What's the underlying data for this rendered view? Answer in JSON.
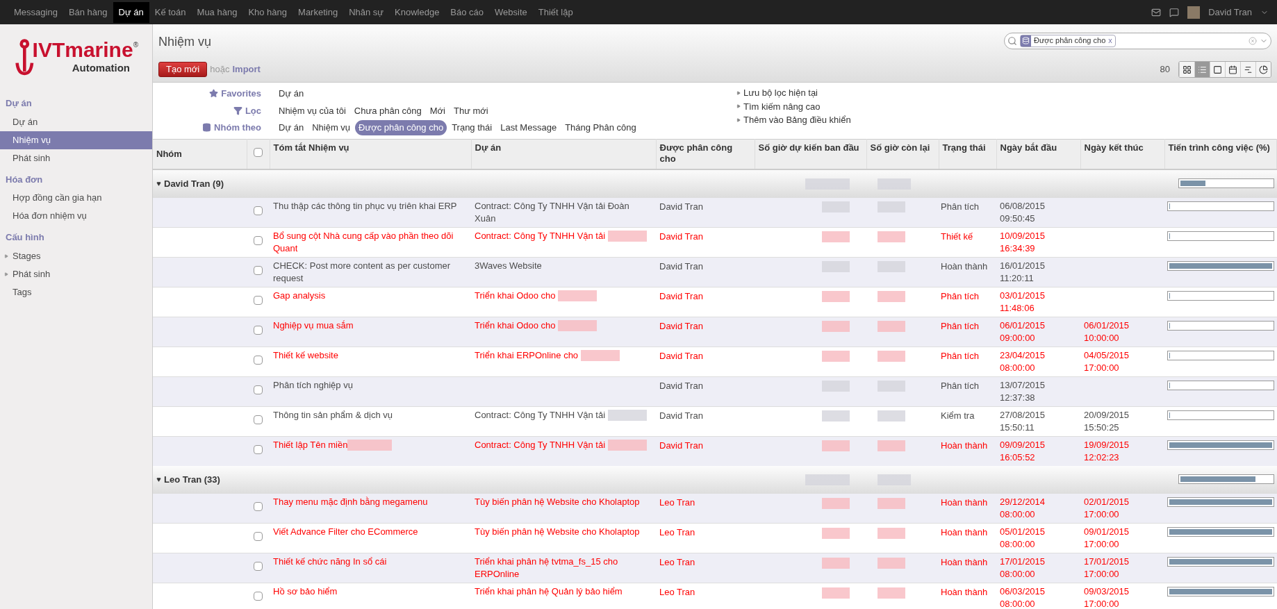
{
  "top_menu": [
    {
      "label": "Messaging",
      "selected": false
    },
    {
      "label": "Bán hàng",
      "selected": false
    },
    {
      "label": "Dự án",
      "selected": true
    },
    {
      "label": "Kế toán",
      "selected": false
    },
    {
      "label": "Mua hàng",
      "selected": false
    },
    {
      "label": "Kho hàng",
      "selected": false
    },
    {
      "label": "Marketing",
      "selected": false
    },
    {
      "label": "Nhân sự",
      "selected": false
    },
    {
      "label": "Knowledge",
      "selected": false
    },
    {
      "label": "Báo cáo",
      "selected": false
    },
    {
      "label": "Website",
      "selected": false
    },
    {
      "label": "Thiết lập",
      "selected": false
    }
  ],
  "user": {
    "name": "David Tran"
  },
  "logo": {
    "brand": "IVTmarine",
    "mark": "®",
    "tagline": "Automation"
  },
  "sidebar": [
    {
      "title": "Dự án",
      "items": [
        {
          "label": "Dự án",
          "kind": "link",
          "selected": false
        },
        {
          "label": "Nhiệm vụ",
          "kind": "link",
          "selected": true
        },
        {
          "label": "Phát sinh",
          "kind": "link",
          "selected": false
        }
      ]
    },
    {
      "title": "Hóa đơn",
      "items": [
        {
          "label": "Hợp đồng cần gia hạn",
          "kind": "link",
          "selected": false
        },
        {
          "label": "Hóa đơn nhiệm vụ",
          "kind": "link",
          "selected": false
        }
      ]
    },
    {
      "title": "Cấu hình",
      "items": [
        {
          "label": "Stages",
          "kind": "folder",
          "selected": false
        },
        {
          "label": "Phát sinh",
          "kind": "folder",
          "selected": false
        },
        {
          "label": "Tags",
          "kind": "link",
          "selected": false
        }
      ]
    }
  ],
  "page_title": "Nhiệm vụ",
  "search": {
    "facet": "Được phân công cho",
    "remove": "x"
  },
  "create_button": "Tạo mới",
  "or_text": "hoặc",
  "import_link": "Import",
  "pager": "80",
  "views": [
    {
      "kind": "kanban",
      "selected": false
    },
    {
      "kind": "list",
      "selected": true
    },
    {
      "kind": "form",
      "selected": false
    },
    {
      "kind": "calendar",
      "selected": false
    },
    {
      "kind": "gantt",
      "selected": false
    },
    {
      "kind": "graph",
      "selected": false
    }
  ],
  "filter_groups": [
    {
      "kind": "favorites",
      "label": "Favorites",
      "options": [
        {
          "label": "Dự án",
          "selected": false
        }
      ]
    },
    {
      "kind": "filter",
      "label": "Lọc",
      "options": [
        {
          "label": "Nhiệm vụ của tôi",
          "selected": false
        },
        {
          "label": "Chưa phân công",
          "selected": false
        },
        {
          "label": "Mới",
          "selected": false
        },
        {
          "label": "Thư mới",
          "selected": false
        }
      ]
    },
    {
      "kind": "groupby",
      "label": "Nhóm theo",
      "options": [
        {
          "label": "Dự án",
          "selected": false
        },
        {
          "label": "Nhiệm vụ",
          "selected": false
        },
        {
          "label": "Được phân công cho",
          "selected": true
        },
        {
          "label": "Trạng thái",
          "selected": false
        },
        {
          "label": "Last Message",
          "selected": false
        },
        {
          "label": "Tháng Phân công",
          "selected": false
        }
      ]
    }
  ],
  "filter_actions": [
    "Lưu bộ lọc hiện tại",
    "Tìm kiếm nâng cao",
    "Thêm vào Bảng điều khiển"
  ],
  "table": {
    "select_all_checked": false,
    "columns": [
      "Nhóm",
      "Tóm tắt Nhiệm vụ",
      "Dự án",
      "Được phân công cho",
      "Số giờ dự kiến ban đầu",
      "Số giờ còn lại",
      "Trạng thái",
      "Ngày bắt đầu",
      "Ngày kết thúc",
      "Tiến trình công việc (%)"
    ],
    "groups": [
      {
        "label": "David Tran (9)",
        "expanded": true,
        "level": 0.27,
        "rows": [
          {
            "summary": "Thu thập các thông tin phục vụ triên khai ERP",
            "project": "Contract: Công Ty TNHH Vận tải Đoàn Xuân",
            "project_redacted": false,
            "assignee": "David Tran",
            "stage": "Phân tích",
            "start": "06/08/2015 09:50:45",
            "overdue": false,
            "checked": false,
            "level": 0
          },
          {
            "summary": "Bổ sung cột Nhà cung cấp vào phần theo dõi Quant",
            "project": "Contract: Công Ty TNHH Vận tải",
            "project_redacted": true,
            "assignee": "David Tran",
            "stage": "Thiết kế",
            "start": "10/09/2015 16:34:39",
            "overdue": true,
            "checked": false,
            "level": 0
          },
          {
            "summary": "CHECK: Post more content as per customer request",
            "project": "3Waves Website",
            "project_redacted": false,
            "assignee": "David Tran",
            "stage": "Hoàn thành",
            "start": "16/01/2015 11:20:11",
            "overdue": false,
            "checked": false,
            "level": 1
          },
          {
            "summary": "Gap analysis",
            "project": "Triển khai Odoo cho",
            "project_redacted": true,
            "assignee": "David Tran",
            "stage": "Phân tích",
            "start": "03/01/2015 11:48:06",
            "overdue": true,
            "checked": false,
            "level": 0
          },
          {
            "summary": "Nghiệp vụ mua sắm",
            "project": "Triển khai Odoo cho",
            "project_redacted": true,
            "assignee": "David Tran",
            "stage": "Phân tích",
            "start": "06/01/2015 09:00:00",
            "end": "06/01/2015 10:00:00",
            "overdue": true,
            "checked": false,
            "level": 0
          },
          {
            "summary": "Thiết kế website",
            "project": "Triển khai ERPOnline cho",
            "project_redacted": true,
            "assignee": "David Tran",
            "stage": "Phân tích",
            "start": "23/04/2015 08:00:00",
            "end": "04/05/2015 17:00:00",
            "overdue": true,
            "checked": false,
            "level": 0
          },
          {
            "summary": "Phân tích nghiệp vụ",
            "assignee": "David Tran",
            "stage": "Phân tích",
            "start": "13/07/2015 12:37:38",
            "overdue": false,
            "checked": false,
            "level": 0
          },
          {
            "summary": "Thông tin sản phẩm & dịch vụ",
            "project": "Contract: Công Ty TNHH Vận tải",
            "project_redacted": true,
            "assignee": "David Tran",
            "stage": "Kiểm tra",
            "start": "27/08/2015 15:50:11",
            "end": "20/09/2015 15:50:25",
            "overdue": false,
            "checked": false,
            "level": 0
          },
          {
            "summary": "Thiết lập Tên miền",
            "summary_redacted": true,
            "project": "Contract: Công Ty TNHH Vận tải",
            "project_redacted": true,
            "assignee": "David Tran",
            "stage": "Hoàn thành",
            "start": "09/09/2015 16:05:52",
            "end": "19/09/2015 12:02:23",
            "overdue": true,
            "checked": false,
            "level": 1
          }
        ]
      },
      {
        "label": "Leo Tran (33)",
        "expanded": true,
        "level": 0.82,
        "rows": [
          {
            "summary": "Thay menu mặc định bằng megamenu",
            "project": "Tùy biến phân hệ Website cho Kholaptop",
            "project_redacted": false,
            "assignee": "Leo Tran",
            "stage": "Hoàn thành",
            "start": "29/12/2014 08:00:00",
            "end": "02/01/2015 17:00:00",
            "overdue": true,
            "checked": false,
            "level": 1
          },
          {
            "summary": "Viết Advance Filter cho ECommerce",
            "project": "Tùy biến phân hệ Website cho Kholaptop",
            "project_redacted": false,
            "assignee": "Leo Tran",
            "stage": "Hoàn thành",
            "start": "05/01/2015 08:00:00",
            "end": "09/01/2015 17:00:00",
            "overdue": true,
            "checked": false,
            "level": 1
          },
          {
            "summary": "Thiết kế chức năng In sổ cái",
            "project": "Triển khai phân hệ tvtma_fs_15 cho ERPOnline",
            "project_redacted": false,
            "assignee": "Leo Tran",
            "stage": "Hoàn thành",
            "start": "17/01/2015 08:00:00",
            "end": "17/01/2015 17:00:00",
            "overdue": true,
            "checked": false,
            "level": 1
          },
          {
            "summary": "Hồ sơ bảo hiểm",
            "project": "Triển khai phân hệ Quản lý bảo hiểm",
            "project_redacted": false,
            "assignee": "Leo Tran",
            "stage": "Hoàn thành",
            "start": "06/03/2015 08:00:00",
            "end": "09/03/2015 17:00:00",
            "overdue": true,
            "checked": false,
            "level": 1
          }
        ]
      }
    ]
  }
}
